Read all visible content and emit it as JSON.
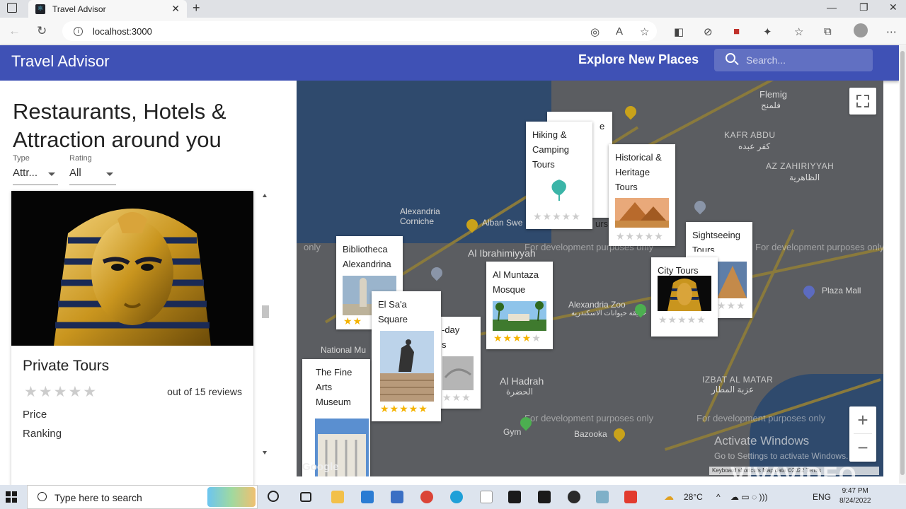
{
  "browser": {
    "tab_title": "Travel Advisor",
    "url": "localhost:3000"
  },
  "header": {
    "title": "Travel Advisor",
    "explore": "Explore New Places",
    "search_placeholder": "Search..."
  },
  "list": {
    "heading": "Restaurants, Hotels & Attraction around you",
    "type_label": "Type",
    "type_value": "Attr...",
    "rating_label": "Rating",
    "rating_value": "All",
    "card": {
      "name": "Private Tours",
      "rating": 0,
      "reviews": "out of 15 reviews",
      "price_label": "Price",
      "ranking_label": "Ranking"
    }
  },
  "map": {
    "labels": {
      "kafr_abdu": "KAFR ABDU",
      "kafr_abdu_ar": "كفر عبده",
      "az_zahiriyyah": "AZ ZAHIRIYYAH",
      "az_zahiriyyah_ar": "الظاهرية",
      "flemig": "Flemig",
      "flemig_ar": "فلمنج",
      "alex_corniche": "Alexandria Corniche",
      "alban_swe": "Alban Swe",
      "al_ibrahimiyyah": "Al Ibrahimiyyah",
      "alex_zoo": "Alexandria Zoo",
      "alex_zoo_ar": "حديقة حيوانات الاسكندرية",
      "al_hadrah": "Al Hadrah",
      "al_hadrah_ar": "الحضرة",
      "izbat_al_matar": "IZBAT AL MATAR",
      "izbat_al_matar_ar": "عزبة المطار",
      "bazooka": "Bazooka",
      "plaza_mall": "Plaza Mall",
      "national_mu": "National Mu",
      "gym": "Gym",
      "dev_purposes": "For development purposes only",
      "dev_only": "only"
    },
    "google": "Google",
    "attribution": "Keyboard shortcuts   Map data ©2022   Terms",
    "zoom_in": "+",
    "zoom_out": "−",
    "activate_title": "Activate Windows",
    "activate_sub": "Go to Settings to activate Windows.",
    "popups": [
      {
        "title": "Hiking & Camping Tours",
        "rating": 0
      },
      {
        "title": "Historical & Heritage Tours",
        "rating": 0
      },
      {
        "title": "Sightseeing Tours",
        "rating": 0
      },
      {
        "title": "City Tours",
        "rating": 0
      },
      {
        "title": "Al Muntaza Mosque",
        "rating": 4
      },
      {
        "title": "Bibliotheca Alexandrina",
        "rating": 2
      },
      {
        "title": "El Sa'a Square",
        "rating": 5
      },
      {
        "title": "-day\ns",
        "rating": 0
      },
      {
        "title": "The Fine Arts Museum",
        "rating": 0
      }
    ],
    "partial_behind": [
      "e",
      "urs"
    ]
  },
  "taskbar": {
    "search_text": "Type here to search",
    "temperature": "28°C",
    "language": "ENG",
    "time": "9:47 PM",
    "date": "8/24/2022"
  },
  "watermark": "VIVAVIDEO",
  "colors": {
    "appbar": "#3f51b5",
    "star_on": "#f5b301",
    "star_off": "#cccccc",
    "map_land": "#5b5d61",
    "map_water": "#2f4a6d"
  }
}
